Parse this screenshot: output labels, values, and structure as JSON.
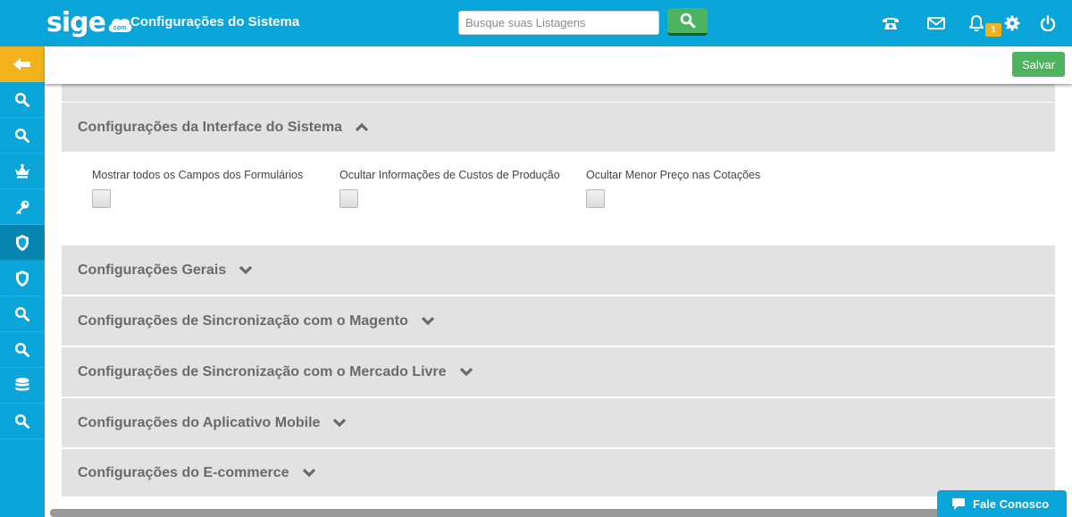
{
  "header": {
    "logo_text": "sige",
    "logo_sub": "com",
    "title": "Configurações do Sistema",
    "search_placeholder": "Busque suas Listagens",
    "notification_count": "1"
  },
  "sidebar": {
    "items": [
      {
        "icon": "search-icon"
      },
      {
        "icon": "search-icon"
      },
      {
        "icon": "crown-icon"
      },
      {
        "icon": "key-icon"
      },
      {
        "icon": "shield-icon",
        "active": true
      },
      {
        "icon": "shield-icon"
      },
      {
        "icon": "search-icon"
      },
      {
        "icon": "search-icon"
      },
      {
        "icon": "database-icon"
      },
      {
        "icon": "search-icon"
      }
    ]
  },
  "toolbar": {
    "save_label": "Salvar"
  },
  "sections": {
    "interface": {
      "title": "Configurações da Interface do Sistema",
      "expanded": true,
      "fields": [
        {
          "label": "Mostrar todos os Campos dos Formulários",
          "checked": false
        },
        {
          "label": "Ocultar Informações de Custos de Produção",
          "checked": false
        },
        {
          "label": "Ocultar Menor Preço nas Cotações",
          "checked": false
        }
      ]
    },
    "gerais": "Configurações Gerais",
    "magento": "Configurações de Sincronização com o Magento",
    "mercado_livre": "Configurações de Sincronização com o Mercado Livre",
    "mobile": "Configurações do Aplicativo Mobile",
    "ecommerce": "Configurações do E-commerce"
  },
  "chat": {
    "label": "Fale Conosco"
  },
  "colors": {
    "brand": "#0aa5d9",
    "accent_green": "#4cb35e",
    "back_orange": "#f3b21b",
    "section_bg": "#e2e2e2",
    "section_text": "#6a6a6a"
  }
}
